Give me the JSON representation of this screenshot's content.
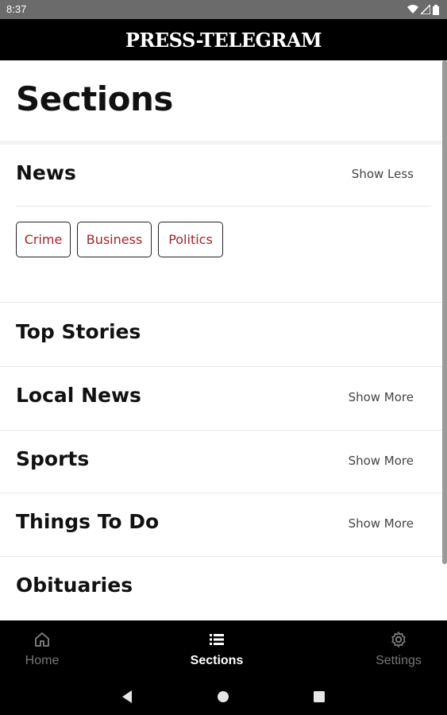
{
  "status_bar": {
    "time": "8:37"
  },
  "header": {
    "logo": "PRESS-TELEGRAM"
  },
  "page": {
    "title": "Sections"
  },
  "sections": [
    {
      "name": "News",
      "toggle": "Show Less",
      "subsections": [
        "Crime",
        "Business",
        "Politics"
      ]
    },
    {
      "name": "Top Stories",
      "toggle": ""
    },
    {
      "name": "Local News",
      "toggle": "Show More"
    },
    {
      "name": "Sports",
      "toggle": "Show More"
    },
    {
      "name": "Things To Do",
      "toggle": "Show More"
    },
    {
      "name": "Obituaries",
      "toggle": ""
    }
  ],
  "bottom_nav": {
    "items": [
      {
        "label": "Home",
        "icon": "home-icon"
      },
      {
        "label": "Sections",
        "icon": "list-icon",
        "active": true
      },
      {
        "label": "Settings",
        "icon": "gear-icon"
      }
    ]
  },
  "colors": {
    "accent": "#a3242c",
    "bar": "#000000",
    "status_bar": "#6b6b6b",
    "inactive": "#777777"
  }
}
